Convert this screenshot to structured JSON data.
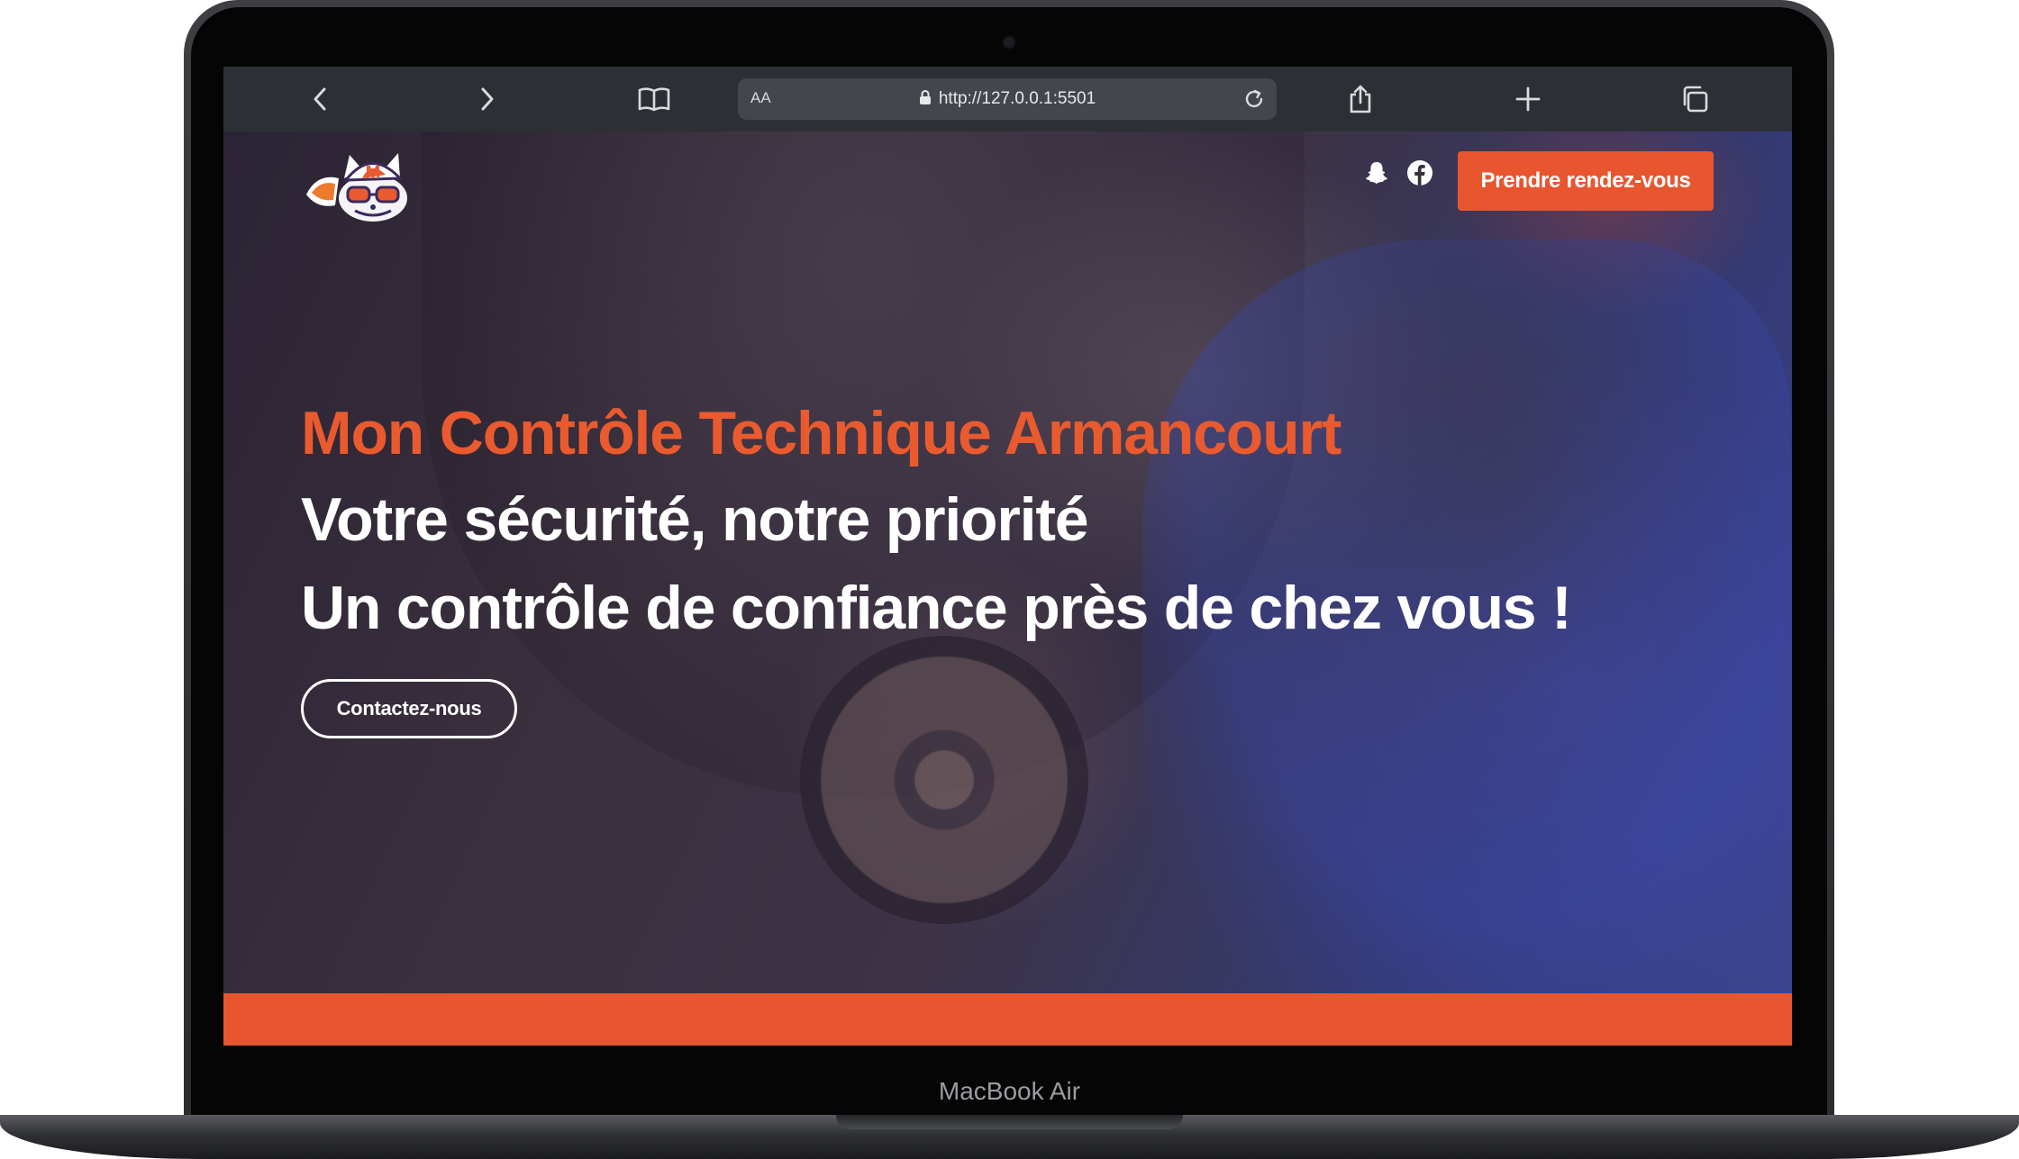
{
  "device": {
    "label": "MacBook Air"
  },
  "browser": {
    "aa_label": "AA",
    "url": "http://127.0.0.1:5501",
    "icons": [
      "chevron-left-icon",
      "chevron-right-icon",
      "book-icon",
      "lock-icon",
      "reload-icon",
      "share-icon",
      "plus-icon",
      "tabs-icon"
    ]
  },
  "site": {
    "cta_label": "Prendre rendez-vous",
    "social_icons": [
      "snapchat-icon",
      "facebook-icon"
    ],
    "hero": {
      "line1": "Mon Contrôle Technique Armancourt",
      "line2": "Votre sécurité, notre priorité",
      "line3": "Un contrôle de confiance près de chez vous !",
      "contact_label": "Contactez-nous"
    }
  },
  "colors": {
    "accent": "#e8562f",
    "browser_bar": "#2c3035",
    "text_light": "#ffffff"
  }
}
